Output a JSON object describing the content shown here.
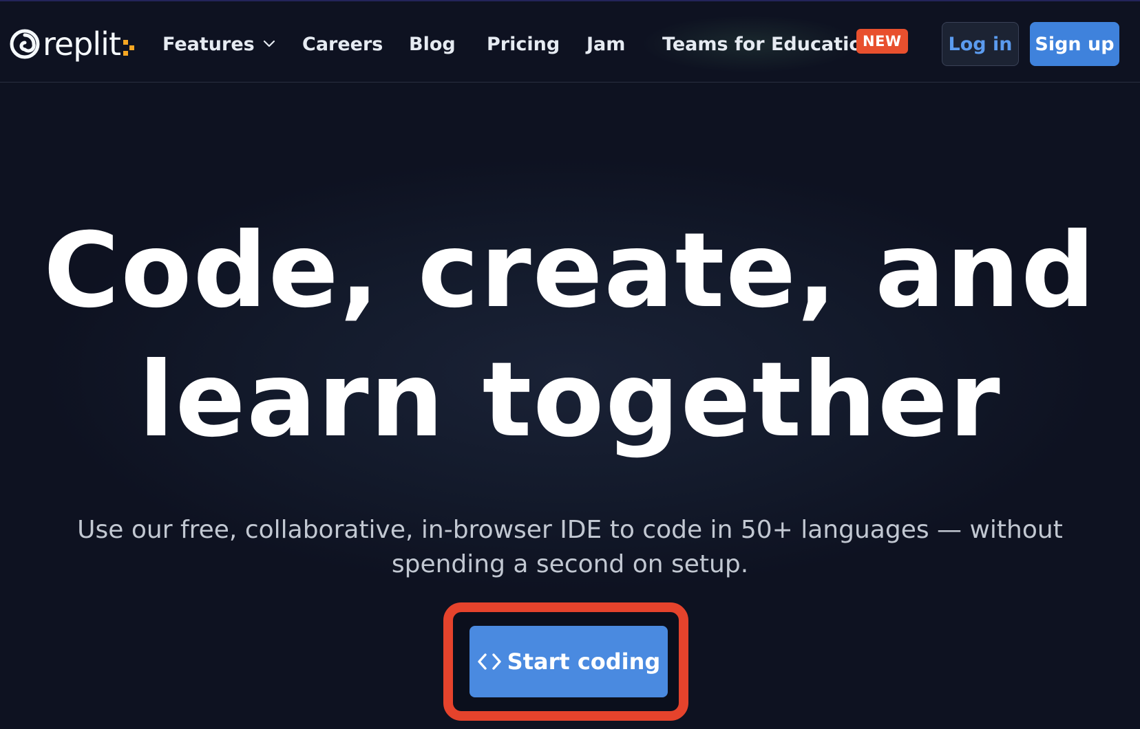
{
  "header": {
    "logo_text": "replit",
    "nav": {
      "features": "Features",
      "careers": "Careers",
      "blog": "Blog",
      "pricing": "Pricing",
      "jam": "Jam",
      "teams": "Teams for Education",
      "new_badge": "NEW"
    },
    "login_label": "Log in",
    "signup_label": "Sign up"
  },
  "hero": {
    "title_line1": "Code, create, and",
    "title_line2": "learn together",
    "subtitle_line1": "Use our free, collaborative, in-browser IDE to code in 50+ languages — without",
    "subtitle_line2": "spending a second on setup.",
    "cta_label": "Start coding"
  },
  "icons": {
    "logo": "replit-logo-icon",
    "features_chevron": "chevron-down-icon",
    "cta": "code-icon"
  },
  "colors": {
    "background": "#0e1221",
    "primary_button": "#3f82dc",
    "new_badge": "#e8502e",
    "highlight_outline": "#e5432c",
    "logo_accent": "#f5a623"
  }
}
